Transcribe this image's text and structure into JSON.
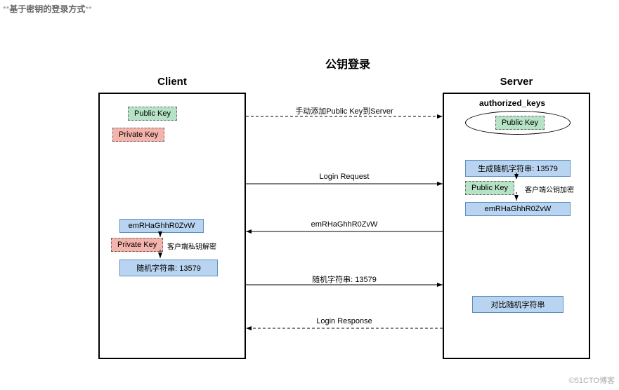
{
  "page": {
    "caption_prefix": "**",
    "caption": "基于密钥的登录方式",
    "caption_suffix": "**",
    "watermark": "©51CTO博客"
  },
  "diagram": {
    "title": "公钥登录",
    "client_label": "Client",
    "server_label": "Server",
    "client": {
      "public_key": "Public Key",
      "private_key_top": "Private Key",
      "encrypted": "emRHaGhhR0ZvW",
      "private_key_mid": "Private Key",
      "decrypt_note": "客户端私钥解密",
      "random_plain": "随机字符串: 13579"
    },
    "server": {
      "auth_keys_label": "authorized_keys",
      "public_key_oval": "Public Key",
      "gen_random": "生成随机字符串: 13579",
      "public_key_enc": "Public Key",
      "encrypt_note": "客户端公钥加密",
      "encrypted": "emRHaGhhR0ZvW",
      "compare": "对比随机字符串"
    },
    "arrows": {
      "a1": "手动添加Public Key到Server",
      "a2": "Login Request",
      "a3": "emRHaGhhR0ZvW",
      "a4": "随机字符串: 13579",
      "a5": "Login Response"
    }
  }
}
